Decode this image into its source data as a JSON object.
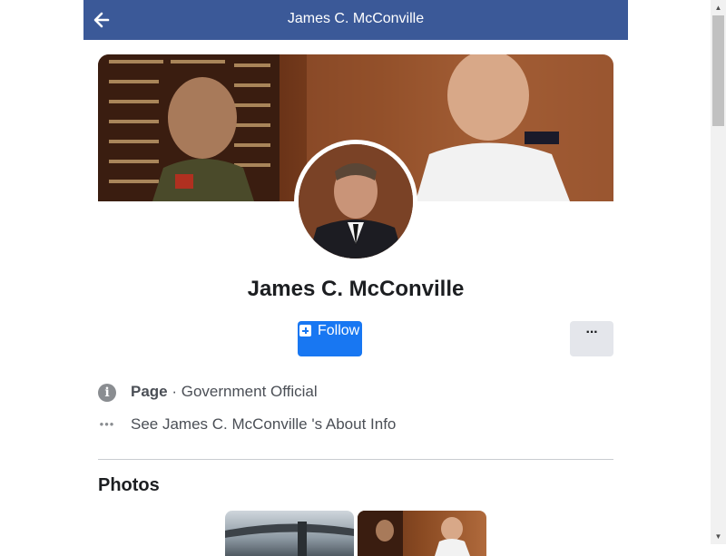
{
  "topbar": {
    "title": "James C. McConville",
    "back_icon": "arrow-left-icon",
    "background": "#3b5998"
  },
  "profile": {
    "name": "James C. McConville",
    "follow_label": "Follow",
    "more_label": "···"
  },
  "info": {
    "page_type_label": "Page",
    "separator": " · ",
    "category": "Government Official",
    "about_link": "See James C. McConville 's About Info"
  },
  "photos": {
    "title": "Photos"
  },
  "colors": {
    "primary_button": "#1877f2",
    "secondary_button": "#e4e6eb",
    "text": "#1c1e21",
    "muted": "#4b4f56"
  }
}
